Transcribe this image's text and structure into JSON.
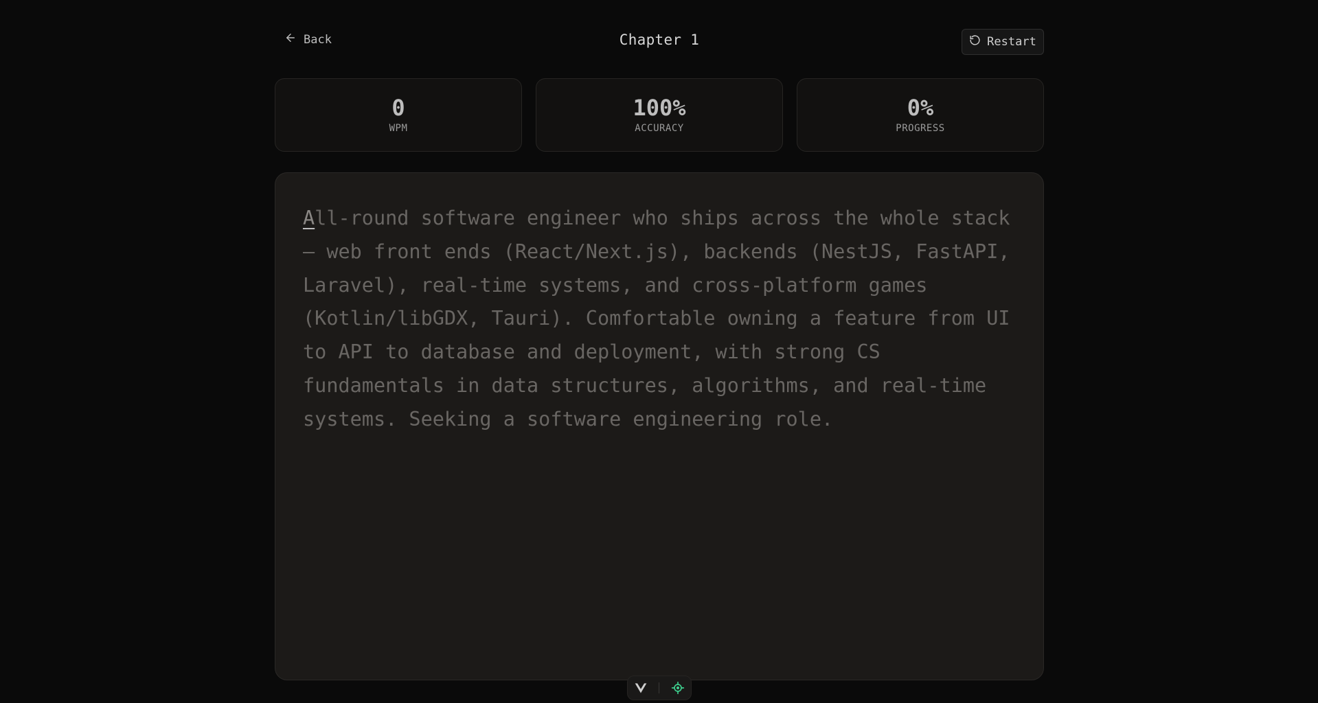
{
  "header": {
    "back_label": "Back",
    "title": "Chapter 1",
    "restart_label": "Restart"
  },
  "stats": {
    "wpm": {
      "value": "0",
      "label": "WPM"
    },
    "accuracy": {
      "value": "100%",
      "label": "ACCURACY"
    },
    "progress": {
      "value": "0%",
      "label": "PROGRESS"
    }
  },
  "typing": {
    "first_char": "A",
    "rest_text": "ll-round software engineer who ships across the whole stack\n— web front ends (React/Next.js), backends (NestJS, FastAPI,\nLaravel), real-time systems, and cross-platform games\n(Kotlin/libGDX, Tauri). Comfortable owning a feature from UI\nto API to database and deployment, with strong CS\nfundamentals in data structures, algorithms, and real-time\nsystems. Seeking a software engineering role."
  },
  "toolbar": {
    "icons": [
      "vue-logo-icon",
      "crosshair-icon"
    ],
    "accent_color": "#3ecf8e"
  }
}
